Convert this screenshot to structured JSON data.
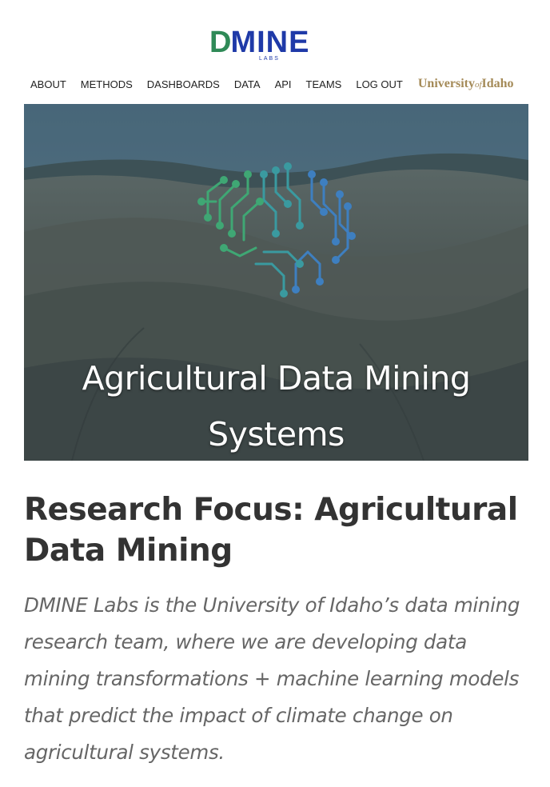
{
  "logo": {
    "d": "D",
    "rest": "MINE",
    "sub": "LABS"
  },
  "nav": {
    "items": [
      {
        "label": "ABOUT"
      },
      {
        "label": "METHODS"
      },
      {
        "label": "DASHBOARDS"
      },
      {
        "label": "DATA"
      },
      {
        "label": "API"
      },
      {
        "label": "TEAMS"
      },
      {
        "label": "LOG OUT"
      }
    ],
    "university": {
      "pre": "University",
      "of": "of",
      "post": "Idaho"
    }
  },
  "hero": {
    "title_line1": "Agricultural Data Mining",
    "title_line2": "Systems",
    "icon": "circuit-brain-icon"
  },
  "content": {
    "heading": "Research Focus: Agricultural Data Mining",
    "intro": "DMINE Labs is the University of Idaho’s data mining research team, where we are developing data mining transformations + machine learning models that predict the impact of climate change on agricultural systems."
  },
  "colors": {
    "logo_green": "#2f8a57",
    "logo_blue": "#1f3aa8",
    "university_gold": "#a48a57",
    "hero_overlay": "#2d4a5c"
  }
}
